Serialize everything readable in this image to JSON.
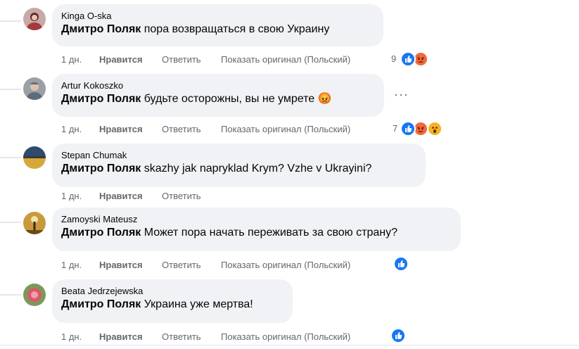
{
  "comments": [
    {
      "author": "Kinga O-ska",
      "mention": "Дмитро Поляк",
      "text": " пора возвращаться в свою Украину",
      "time": "1 дн.",
      "like": "Нравится",
      "reply": "Ответить",
      "translate": "Показать оригинал (Польский)",
      "reaction_count": "9",
      "reactions": [
        "like-icon",
        "angry-icon"
      ]
    },
    {
      "author": "Artur Kokoszko",
      "mention": "Дмитро Поляк",
      "text": " будьте осторожны, вы не умрете ",
      "emoji": "😡",
      "time": "1 дн.",
      "like": "Нравится",
      "reply": "Ответить",
      "translate": "Показать оригинал (Польский)",
      "reaction_count": "7",
      "reactions": [
        "like-icon",
        "angry-icon",
        "wow-icon"
      ],
      "more": "···"
    },
    {
      "author": "Stepan Chumak",
      "mention": "Дмитро Поляк",
      "text": " skazhy jak napryklad Krym? Vzhe v Ukrayini?",
      "time": "1 дн.",
      "like": "Нравится",
      "reply": "Ответить"
    },
    {
      "author": "Zamoyski Mateusz",
      "mention": "Дмитро Поляк",
      "text": " Может пора начать переживать за свою страну?",
      "time": "1 дн.",
      "like": "Нравится",
      "reply": "Ответить",
      "translate": "Показать оригинал (Польский)",
      "reactions": [
        "like-icon"
      ]
    },
    {
      "author": "Beata Jedrzejewska",
      "mention": "Дмитро Поляк",
      "text": " Украина уже мертва!",
      "time": "1 дн.",
      "like": "Нравится",
      "reply": "Ответить",
      "translate": "Показать оригинал (Польский)",
      "reactions": [
        "like-icon"
      ]
    }
  ],
  "colors": {
    "bubble": "#f0f2f5",
    "like_blue": "#1877f2",
    "angry_orange": "#f0683a",
    "wow_yellow": "#f7b125",
    "meta_gray": "#65676b"
  }
}
